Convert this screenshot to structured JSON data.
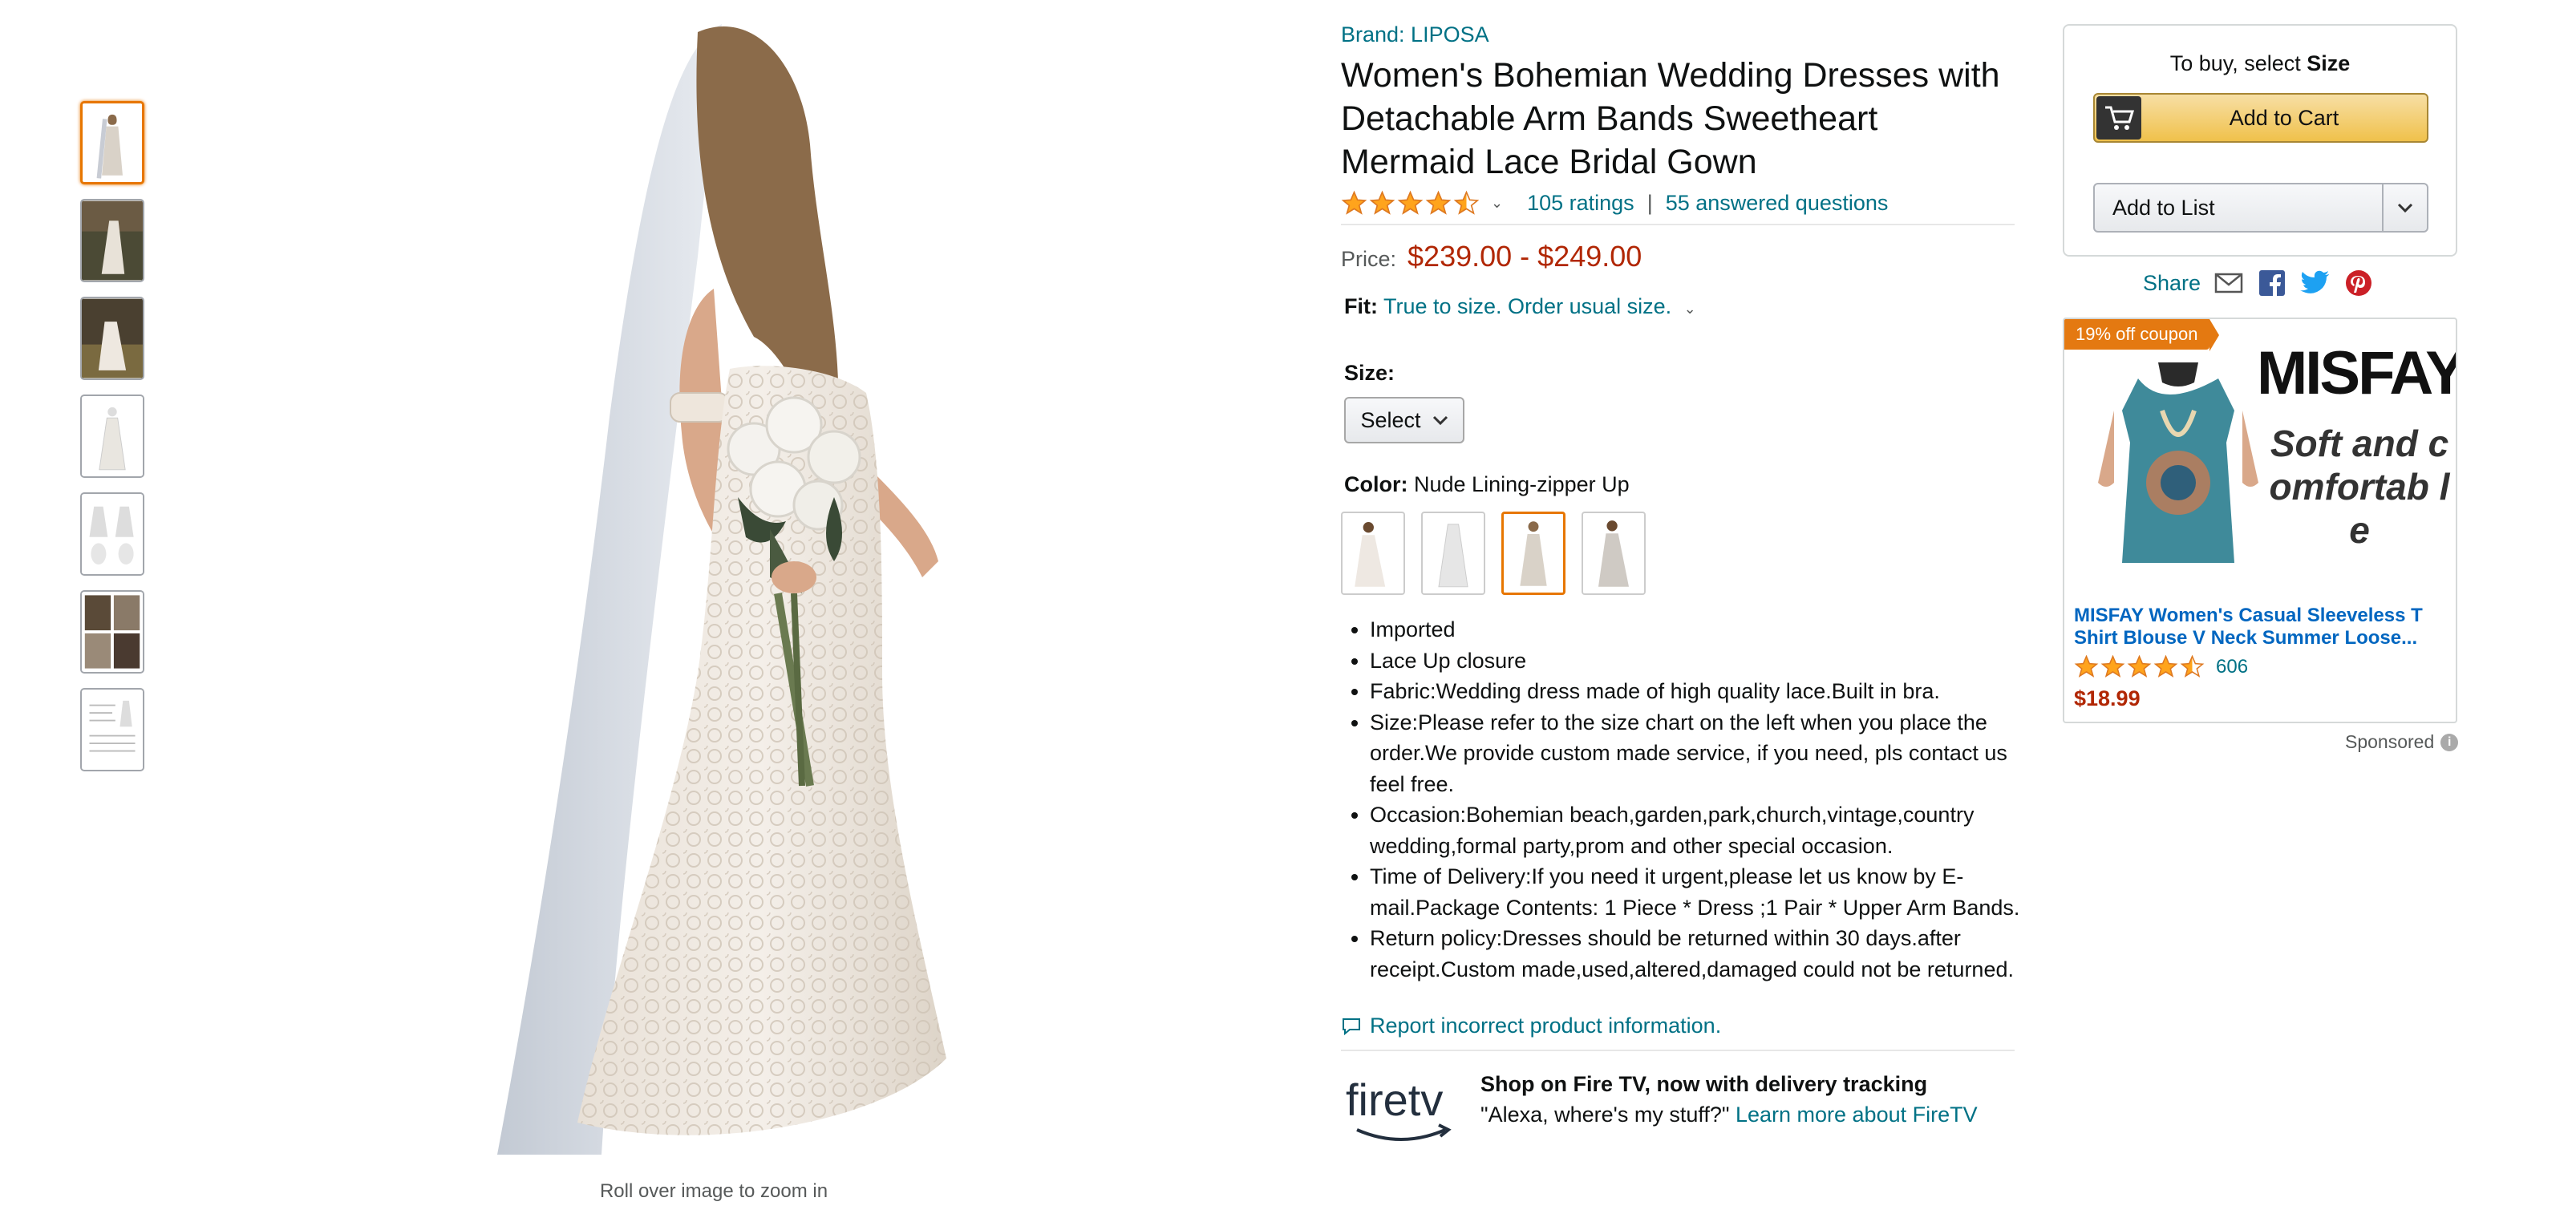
{
  "thumbnails": [
    "Front view",
    "Garden photo",
    "Bride with bouquet",
    "Dress on form",
    "Front and back",
    "Detail collage",
    "Size chart"
  ],
  "main_image": {
    "zoom_hint": "Roll over image to zoom in"
  },
  "product": {
    "brand": "Brand: LIPOSA",
    "title": "Women's Bohemian Wedding Dresses with Detachable Arm Bands Sweetheart Mermaid Lace Bridal Gown",
    "rating_value": 4.5,
    "ratings_text": "105 ratings",
    "separator": "|",
    "questions_text": "55 answered questions",
    "price_label": "Price:",
    "price": "$239.00 - $249.00",
    "fit_label": "Fit:",
    "fit_text": "True to size. Order usual size.",
    "size_label": "Size:",
    "size_select": "Select",
    "color_label": "Color:",
    "color_value": "Nude Lining-zipper Up",
    "bullets": [
      "Imported",
      "Lace Up closure",
      "Fabric:Wedding dress made of high quality lace.Built in bra.",
      "Size:Please refer to the size chart on the left when you place the order.We provide custom made service, if you need, pls contact us feel free.",
      "Occasion:Bohemian beach,garden,park,church,vintage,country wedding,formal party,prom and other special occasion.",
      "Time of Delivery:If you need it urgent,please let us know by E-mail.Package Contents: 1 Piece * Dress ;1 Pair * Upper Arm Bands.",
      "Return policy:Dresses should be returned within 30 days.after receipt.Custom made,used,altered,damaged could not be returned."
    ],
    "report_link": "Report incorrect product information."
  },
  "firetv": {
    "logo_text": "firetv",
    "heading": "Shop on Fire TV, now with delivery tracking",
    "quote": "\"Alexa, where's my stuff?\"",
    "link": "Learn more about FireTV"
  },
  "buybox": {
    "to_buy_prefix": "To buy, select ",
    "to_buy_bold": "Size",
    "add_to_cart": "Add to Cart",
    "add_to_list": "Add to List",
    "share_label": "Share"
  },
  "ad": {
    "coupon": "19% off coupon",
    "brand": "MISFAY",
    "tagline": "Soft and comfortab le",
    "title": "MISFAY Women's Casual Sleeveless T Shirt Blouse V Neck Summer Loose...",
    "rating_value": 4.5,
    "rating_count": "606",
    "price": "$18.99",
    "sponsored": "Sponsored"
  },
  "colors": {
    "link": "#007185",
    "price": "#B12704",
    "accent": "#e77600",
    "star": "#FFA41C"
  }
}
